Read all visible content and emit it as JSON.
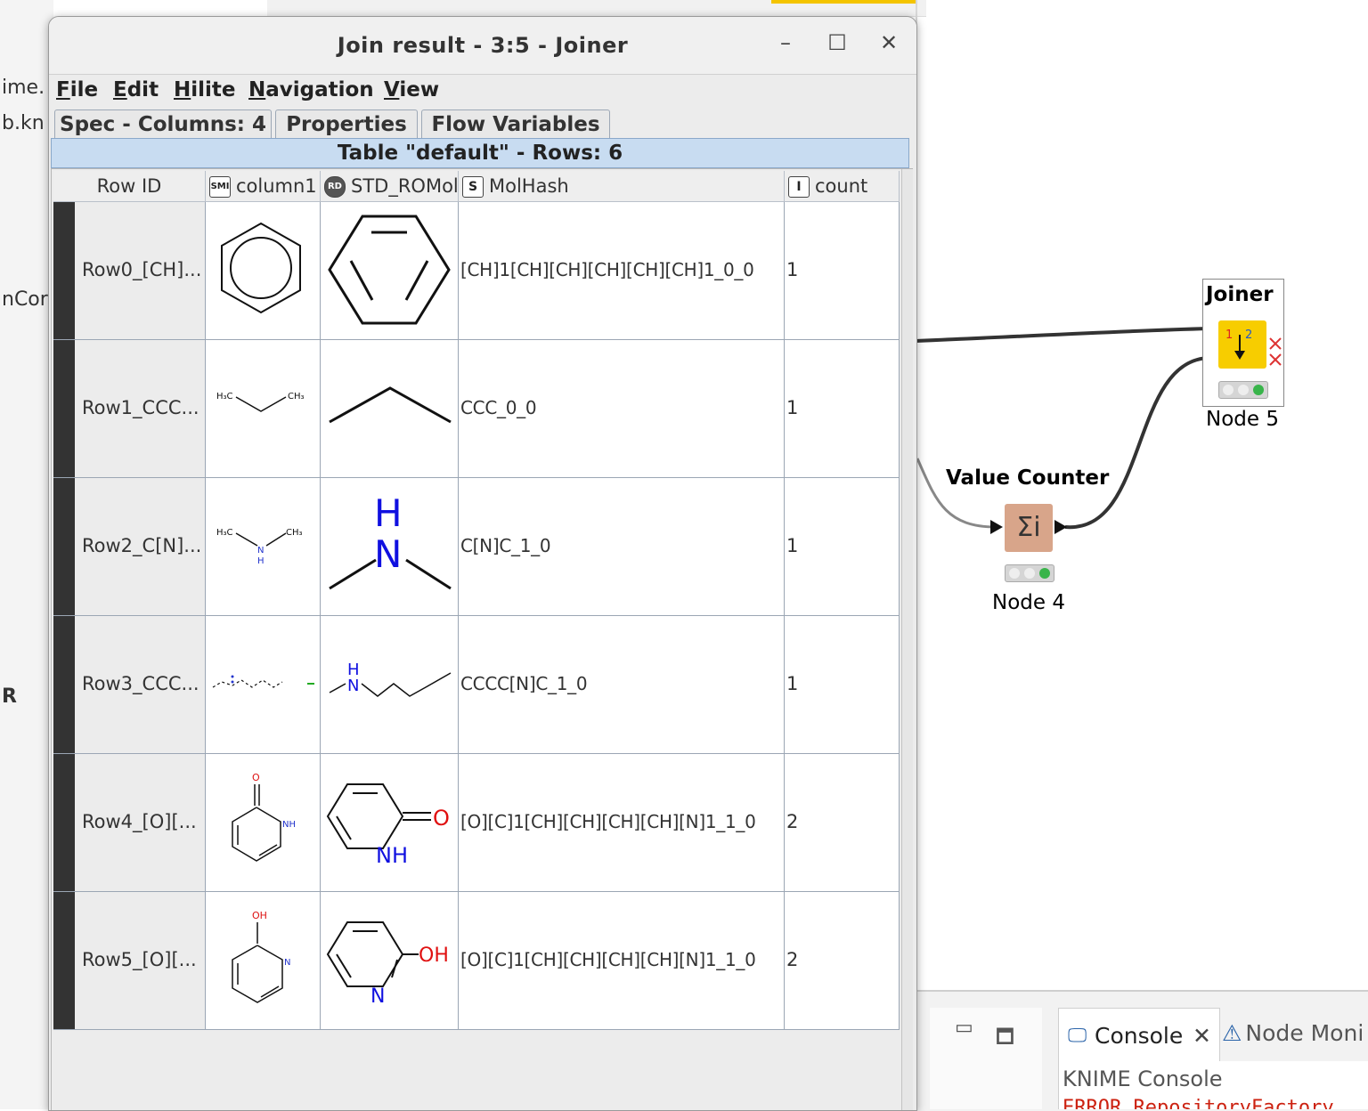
{
  "background": {
    "left_fragments": [
      "ime.",
      "b.kn",
      "nCor",
      "R"
    ],
    "bottom_panel": {
      "console_tab_label": "Console",
      "monitor_tab_label": "Node Moni",
      "console_title": "KNIME Console",
      "console_error_line": "ERROR RepositoryFactory"
    },
    "nodes": {
      "joiner": {
        "title": "Joiner",
        "name": "Node 5",
        "icon_color": "#f7cd00"
      },
      "value_counter": {
        "title": "Value Counter",
        "name": "Node 4",
        "icon_glyph": "Σi",
        "icon_color": "#d8a58a"
      }
    }
  },
  "dialog": {
    "title": "Join result - 3:5 - Joiner",
    "menu": [
      "File",
      "Edit",
      "Hilite",
      "Navigation",
      "View"
    ],
    "tabs": [
      "Spec - Columns: 4",
      "Properties",
      "Flow Variables"
    ],
    "table_header": "Table \"default\" - Rows: 6",
    "columns": [
      {
        "label": "Row ID",
        "type_icon": ""
      },
      {
        "label": "column1",
        "type_icon": "SMI"
      },
      {
        "label": "STD_ROMol",
        "type_icon": "RD"
      },
      {
        "label": "MolHash",
        "type_icon": "S"
      },
      {
        "label": "count",
        "type_icon": "I"
      }
    ],
    "rows": [
      {
        "row_id": "Row0_[CH]...",
        "molhash": "[CH]1[CH][CH][CH][CH][CH]1_0_0",
        "count": "1",
        "molecule": "benzene"
      },
      {
        "row_id": "Row1_CCC...",
        "molhash": "CCC_0_0",
        "count": "1",
        "molecule": "propane"
      },
      {
        "row_id": "Row2_C[N]...",
        "molhash": "C[N]C_1_0",
        "count": "1",
        "molecule": "dimethylamine"
      },
      {
        "row_id": "Row3_CCC...",
        "molhash": "CCCC[N]C_1_0",
        "count": "1",
        "molecule": "n-methylbutylamine"
      },
      {
        "row_id": "Row4_[O][...",
        "molhash": "[O][C]1[CH][CH][CH][CH][N]1_1_0",
        "count": "2",
        "molecule": "2-pyridone"
      },
      {
        "row_id": "Row5_[O][...",
        "molhash": "[O][C]1[CH][CH][CH][CH][N]1_1_0",
        "count": "2",
        "molecule": "2-hydroxypyridine"
      }
    ],
    "molecule_labels": {
      "h3c": "H₃C",
      "ch3": "CH₃",
      "h": "H",
      "n": "N",
      "nh": "NH",
      "o": "O",
      "oh": "OH"
    }
  }
}
